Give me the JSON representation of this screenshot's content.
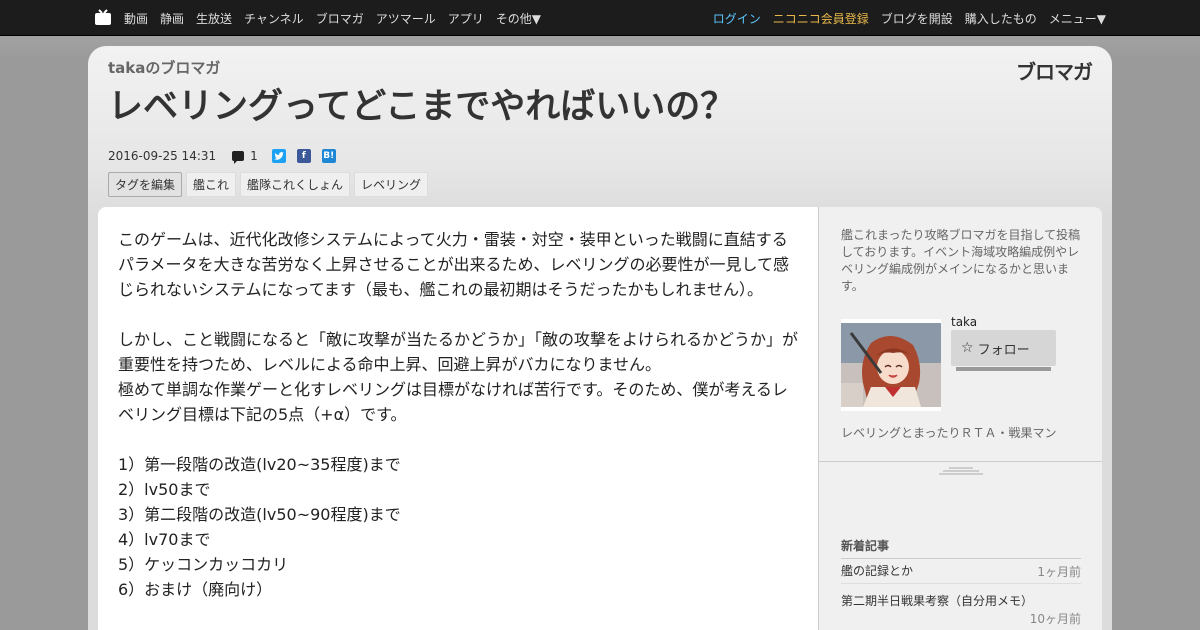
{
  "topnav": {
    "left_items": [
      "動画",
      "静画",
      "生放送",
      "チャンネル",
      "ブロマガ",
      "アツマール",
      "アプリ",
      "その他▼"
    ],
    "login": "ログイン",
    "premium": "ニコニコ会員登録",
    "right_items": [
      "ブログを開設",
      "購入したもの",
      "メニュー▼"
    ]
  },
  "header": {
    "blog_name": "takaのブロマガ",
    "logo_text": "ブロマガ",
    "title": "レベリングってどこまでやればいいの？",
    "date": "2016-09-25 14:31",
    "comment_count": "1",
    "share_icons": [
      "twitter-icon",
      "facebook-icon",
      "hatena-bookmark-icon"
    ],
    "share_marks": [
      "",
      "f",
      "B!"
    ]
  },
  "tags": {
    "edit_label": "タグを編集",
    "items": [
      "艦これ",
      "艦隊これくしょん",
      "レベリング"
    ]
  },
  "article": {
    "paragraphs": [
      "このゲームは、近代化改修システムによって火力・雷装・対空・装甲といった戦闘に直結するパラメータを大きな苦労なく上昇させることが出来るため、レベリングの必要性が一見して感じられないシステムになってます（最も、艦これの最初期はそうだったかもしれません）。",
      "しかし、こと戦闘になると「敵に攻撃が当たるかどうか」「敵の攻撃をよけられるかどうか」が重要性を持つため、レベルによる命中上昇、回避上昇がバカになりません。",
      "極めて単調な作業ゲーと化すレベリングは目標がなければ苦行です。そのため、僕が考えるレベリング目標は下記の5点（+α）です。"
    ],
    "list": [
      "1）第一段階の改造(lv20~35程度)まで",
      "2）lv50まで",
      "3）第二段階の改造(lv50~90程度)まで",
      "4）lv70まで",
      "5）ケッコンカッコカリ",
      "6）おまけ（廃向け）"
    ]
  },
  "sidebar": {
    "description": "艦これまったり攻略ブロマガを目指して投稿しております。イベント海域攻略編成例やレベリング編成例がメインになるかと思います。",
    "user_name": "taka",
    "follow_label": "フォロー",
    "tagline": "レベリングとまったりＲＴＡ・戦果マン",
    "recent_heading": "新着記事",
    "recent": [
      {
        "title": "艦の記録とか",
        "ago": "1ヶ月前"
      },
      {
        "title": "第二期半日戦果考察（自分用メモ）",
        "ago": "10ヶ月前"
      }
    ]
  }
}
